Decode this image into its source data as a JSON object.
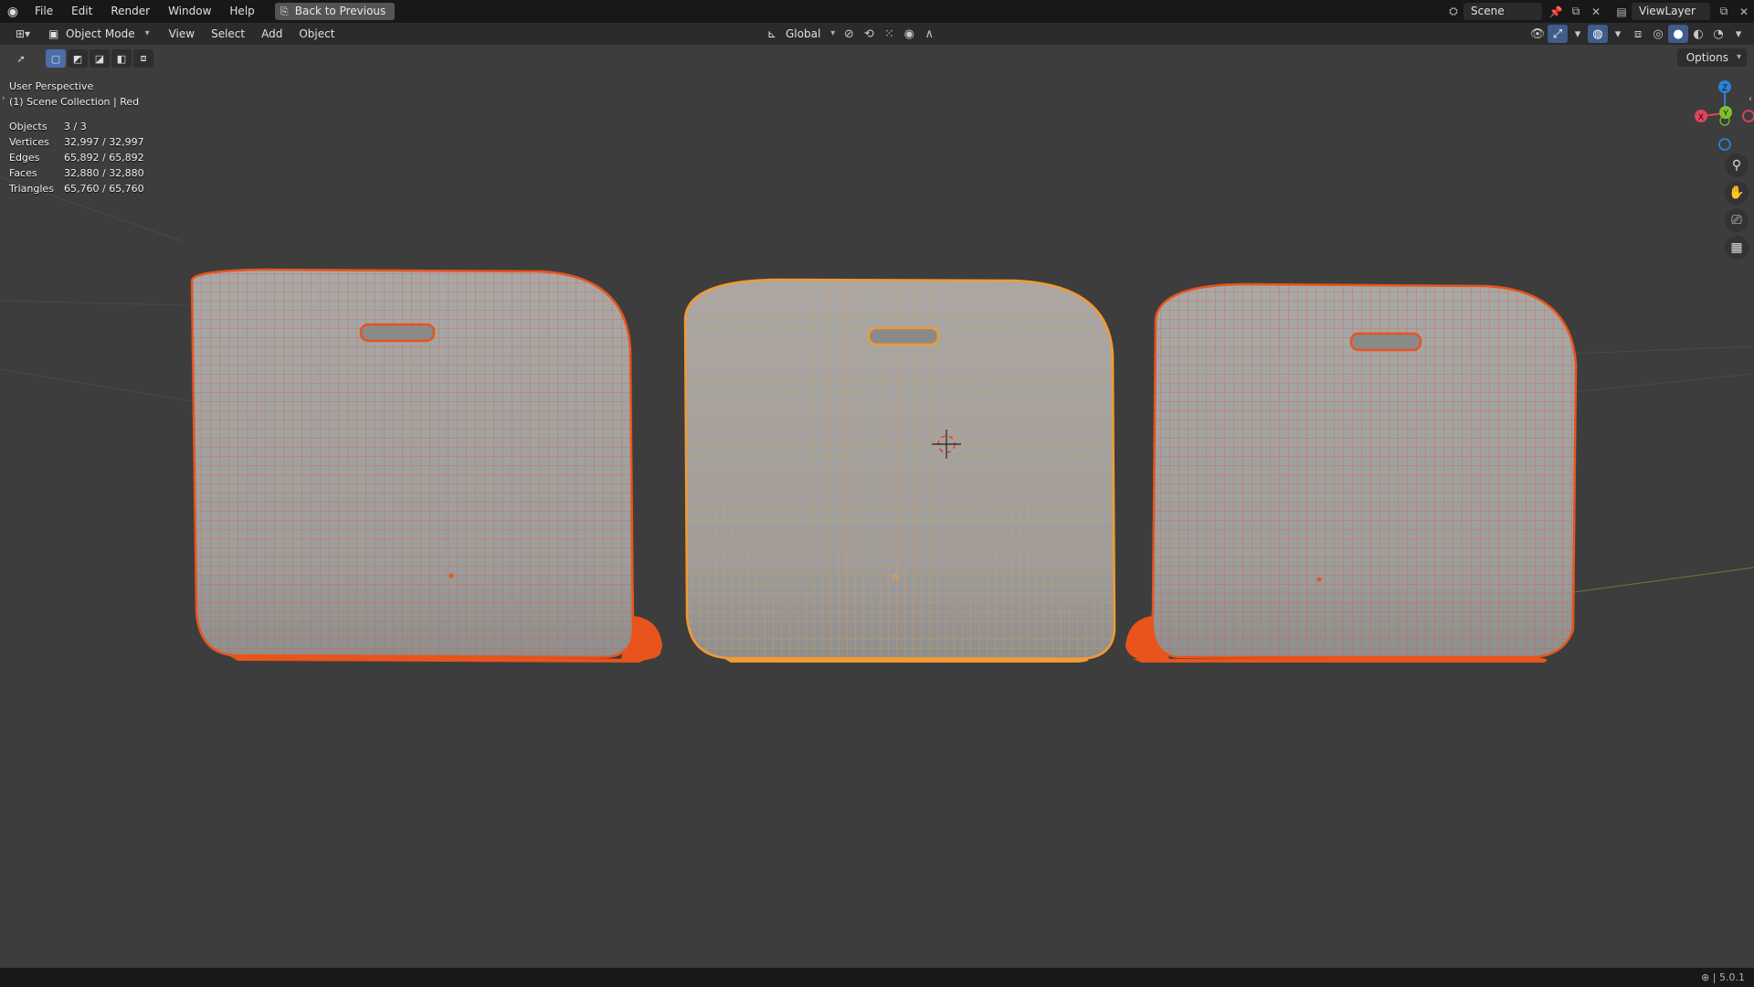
{
  "topbar": {
    "logo_icon": "blender-logo-icon",
    "menus": [
      "File",
      "Edit",
      "Render",
      "Window",
      "Help"
    ],
    "back_button": "Back to Previous",
    "scene_name": "Scene",
    "view_layer": "ViewLayer"
  },
  "header": {
    "mode": "Object Mode",
    "menus": [
      "View",
      "Select",
      "Add",
      "Object"
    ],
    "orientation": "Global"
  },
  "toolbar": {
    "options_label": "Options"
  },
  "overlay": {
    "perspective": "User Perspective",
    "collection": "(1) Scene Collection | Red",
    "stats": [
      {
        "label": "Objects",
        "value": "3 / 3"
      },
      {
        "label": "Vertices",
        "value": "32,997 / 32,997"
      },
      {
        "label": "Edges",
        "value": "65,892 / 65,892"
      },
      {
        "label": "Faces",
        "value": "32,880 / 32,880"
      },
      {
        "label": "Triangles",
        "value": "65,760 / 65,760"
      }
    ]
  },
  "gizmo": {
    "z": "Z",
    "y": "Y",
    "x": "X",
    "colors": {
      "x": "#e0445a",
      "y": "#7ec22a",
      "z": "#2f80d6"
    }
  },
  "colors": {
    "viewport_bg": "#3d3d3d",
    "selected_outline": "#e8541c",
    "active_outline": "#f29a33",
    "mesh_fill": "#a3a3a3"
  },
  "statusbar": {
    "version": "5.0.1"
  }
}
